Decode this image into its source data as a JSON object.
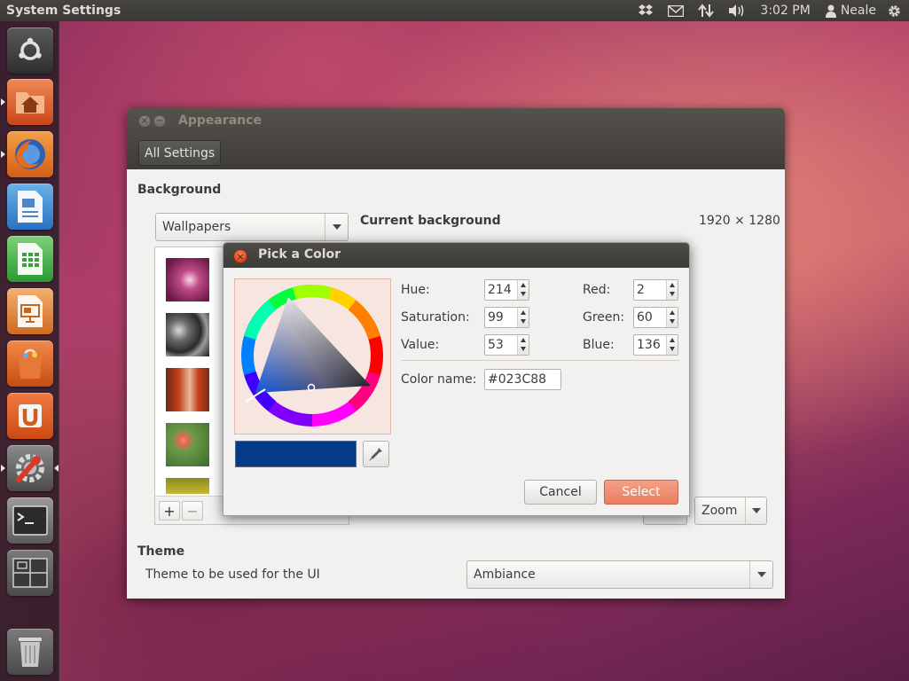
{
  "top_panel": {
    "app_title": "System Settings",
    "clock": "3:02 PM",
    "user": "Neale",
    "icons": [
      "dropbox-icon",
      "mail-icon",
      "network-icon",
      "volume-icon",
      "user-icon",
      "gear-icon"
    ]
  },
  "launcher": {
    "items": [
      "dash-home",
      "home-folder",
      "firefox",
      "libreoffice-writer",
      "libreoffice-calc",
      "libreoffice-impress",
      "ubuntu-software-center",
      "ubuntu-one",
      "system-settings",
      "terminal",
      "workspace-switcher",
      "trash"
    ]
  },
  "appearance": {
    "title": "Appearance",
    "all_settings_label": "All Settings",
    "background_label": "Background",
    "wallpaper_source": "Wallpapers",
    "current_background_label": "Current background",
    "resolution": "1920 × 1280",
    "zoom_option": "Zoom",
    "add_symbol": "+",
    "remove_symbol": "−",
    "theme_label": "Theme",
    "theme_description": "Theme to be used for the UI",
    "theme_value": "Ambiance"
  },
  "picker": {
    "title": "Pick a Color",
    "hue_label": "Hue:",
    "hue": "214",
    "saturation_label": "Saturation:",
    "saturation": "99",
    "value_label": "Value:",
    "value": "53",
    "red_label": "Red:",
    "red": "2",
    "green_label": "Green:",
    "green": "60",
    "blue_label": "Blue:",
    "blue": "136",
    "color_name_label": "Color name:",
    "color_name": "#023C88",
    "cancel_label": "Cancel",
    "select_label": "Select",
    "selected_color": "#023c88"
  }
}
